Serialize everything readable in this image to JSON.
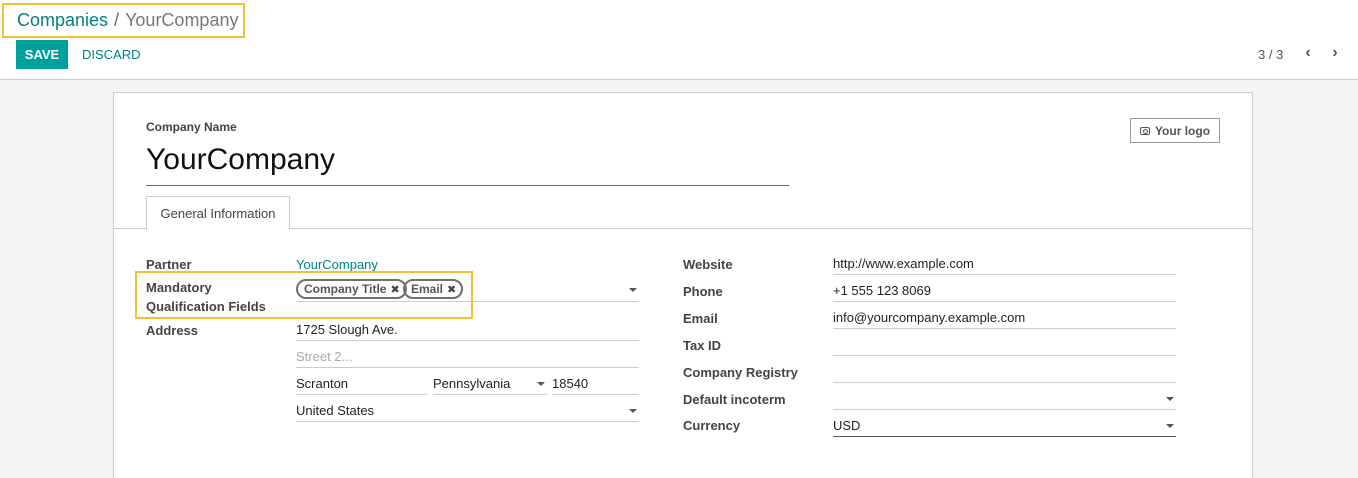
{
  "breadcrumb": {
    "parent": "Companies",
    "separator": "/",
    "current": "YourCompany"
  },
  "actions": {
    "save": "SAVE",
    "discard": "DISCARD"
  },
  "pager": {
    "value": "3 / 3",
    "prev_icon": "chevron-left-icon",
    "next_icon": "chevron-right-icon"
  },
  "form": {
    "company_name_label": "Company Name",
    "company_name": "YourCompany",
    "logo_button": "Your logo",
    "tab": "General Information",
    "left": {
      "partner_label": "Partner",
      "partner_value": "YourCompany",
      "mandatory_label_1": "Mandatory",
      "mandatory_label_2": "Qualification Fields",
      "tags": [
        "Company Title",
        "Email"
      ],
      "address_label": "Address",
      "street": "1725 Slough Ave.",
      "street2_placeholder": "Street 2...",
      "city": "Scranton",
      "state": "Pennsylvania",
      "zip": "18540",
      "country": "United States"
    },
    "right": {
      "website_label": "Website",
      "website": "http://www.example.com",
      "phone_label": "Phone",
      "phone": "+1 555 123 8069",
      "email_label": "Email",
      "email": "info@yourcompany.example.com",
      "taxid_label": "Tax ID",
      "taxid": "",
      "registry_label": "Company Registry",
      "registry": "",
      "incoterm_label": "Default incoterm",
      "incoterm": "",
      "currency_label": "Currency",
      "currency": "USD"
    }
  },
  "colors": {
    "accent": "#00a09d",
    "link": "#018281",
    "highlight": "#f0c239"
  }
}
